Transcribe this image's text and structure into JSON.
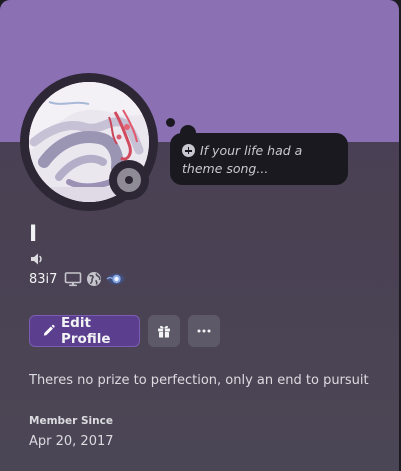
{
  "colors": {
    "banner": "#8b70b3",
    "background": "#1c1b22",
    "ring": "#2d2735",
    "bubble_bg": "#1a1920",
    "bubble_text": "#c9c7cf",
    "text_primary": "#f2f3f5",
    "text_secondary": "#dcdbe0",
    "text_muted": "#c6c4cc",
    "accent_button": "#5b3f8e",
    "accent_button_border": "#7a5db3",
    "icon_button": "#5e5968",
    "status_gray": "#8f8b96",
    "badge_blue": "#89a9e6"
  },
  "profile": {
    "display_name": "I",
    "username": "83i7",
    "custom_status_placeholder": "If your life had a theme song...",
    "bio": "Theres no prize to perfection, only an end to pursuit",
    "member_since_label": "Member Since",
    "member_since_date": "Apr 20, 2017",
    "status": "offline"
  },
  "badges": [
    {
      "icon": "desktop-icon"
    },
    {
      "icon": "globe-icon"
    },
    {
      "icon": "hypesquad-orb-icon"
    }
  ],
  "actions": {
    "edit_profile_label": "Edit Profile",
    "gift_icon": "gift-icon",
    "more_icon": "more-options-icon"
  }
}
